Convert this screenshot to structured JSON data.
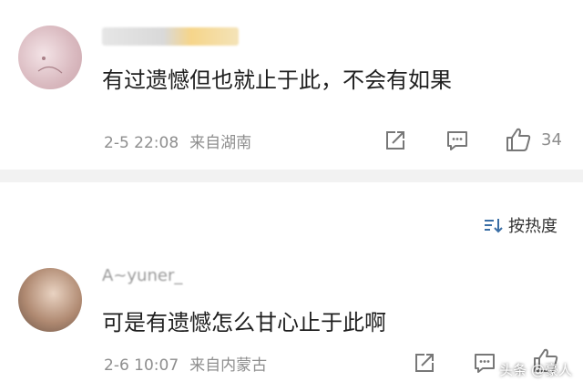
{
  "comments": [
    {
      "text": "有过遗憾但也就止于此，不会有如果",
      "date": "2-5 22:08",
      "location": "来自湖南",
      "likes": "34"
    },
    {
      "username": "A~yuner_",
      "text": "可是有遗憾怎么甘心止于此啊",
      "date": "2-6 10:07",
      "location": "来自内蒙古"
    }
  ],
  "sort": {
    "label": "按热度"
  },
  "icons": {
    "share": "share-icon",
    "comment": "comment-icon",
    "like": "thumbs-up-icon",
    "sort": "sort-icon"
  },
  "watermark": "头条 @豪人"
}
